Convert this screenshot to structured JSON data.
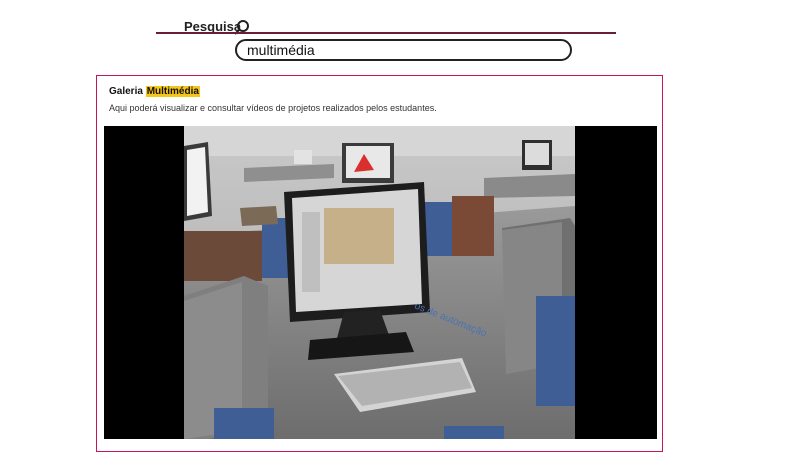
{
  "search": {
    "label": "Pesquisa",
    "value": "multimédia"
  },
  "gallery": {
    "title_prefix": "Galeria",
    "title_highlight": "Multimédia",
    "description": "Aqui poderá visualizar e consultar vídeos de projetos realizados pelos estudantes."
  },
  "colors": {
    "rule": "#6b1e3a",
    "panel_border": "#c2185b",
    "highlight": "#f5c518"
  }
}
